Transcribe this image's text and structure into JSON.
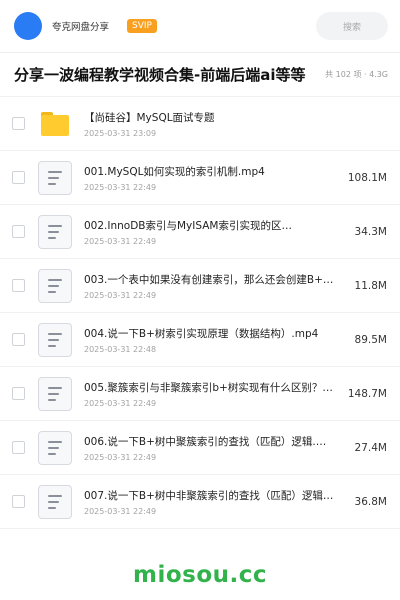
{
  "header": {
    "site_name": "夸克网盘分享",
    "badge": "SVIP",
    "search_placeholder": "搜索"
  },
  "share": {
    "title": "分享一波编程教学视频合集-前端后端ai等等",
    "meta": "共 102 项 · 4.3G"
  },
  "files": [
    {
      "type": "folder",
      "name": "【尚硅谷】MySQL面试专题",
      "date": "2025-03-31 23:09",
      "size": ""
    },
    {
      "type": "file",
      "name": "001.MySQL如何实现的索引机制.mp4",
      "date": "2025-03-31 22:49",
      "size": "108.1M"
    },
    {
      "type": "file",
      "name": "002.InnoDB索引与MyISAM索引实现的区…",
      "date": "2025-03-31 22:49",
      "size": "34.3M"
    },
    {
      "type": "file",
      "name": "003.一个表中如果没有创建索引，那么还会创建B+…",
      "date": "2025-03-31 22:49",
      "size": "11.8M"
    },
    {
      "type": "file",
      "name": "004.说一下B+树索引实现原理（数据结构）.mp4",
      "date": "2025-03-31 22:48",
      "size": "89.5M"
    },
    {
      "type": "file",
      "name": "005.聚簇索引与非聚簇索引b+树实现有什么区别？…",
      "date": "2025-03-31 22:49",
      "size": "148.7M"
    },
    {
      "type": "file",
      "name": "006.说一下B+树中聚簇索引的查找（匹配）逻辑.…",
      "date": "2025-03-31 22:49",
      "size": "27.4M"
    },
    {
      "type": "file",
      "name": "007.说一下B+树中非聚簇索引的查找（匹配）逻辑…",
      "date": "2025-03-31 22:49",
      "size": "36.8M"
    }
  ],
  "watermark": "miosou.cc"
}
